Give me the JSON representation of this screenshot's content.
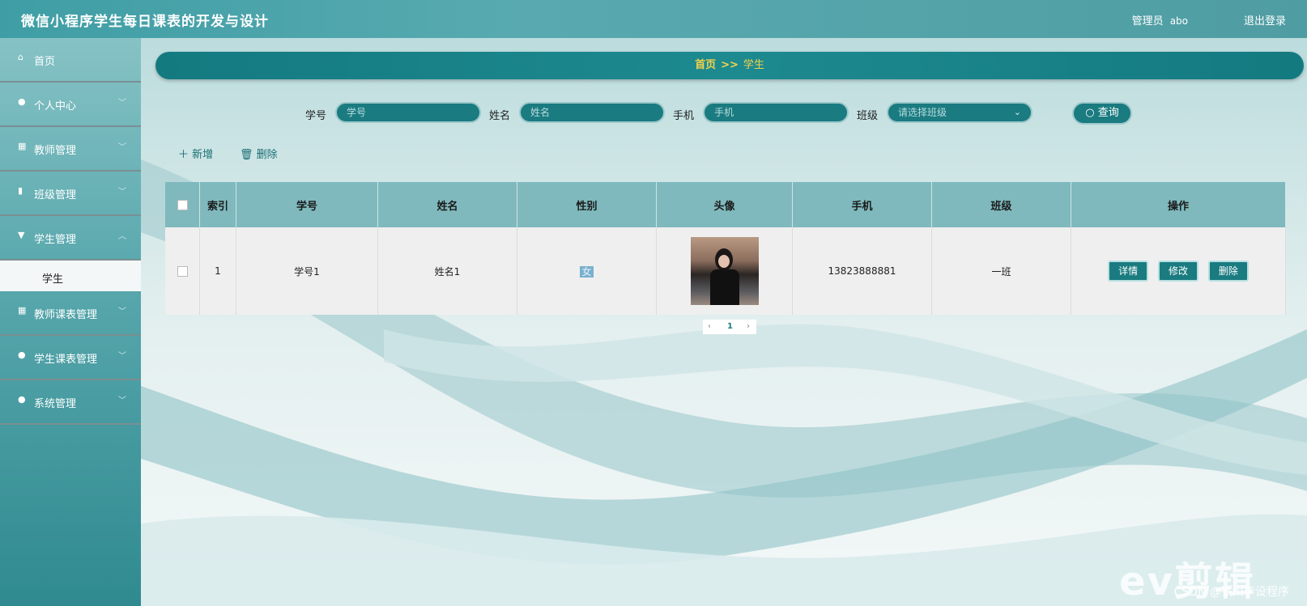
{
  "header": {
    "title": "微信小程序学生每日课表的开发与设计",
    "user_label": "管理员",
    "user_name": "abo",
    "logout": "退出登录"
  },
  "sidebar": {
    "items": [
      {
        "icon": "home-icon",
        "label": "首页"
      },
      {
        "icon": "user-icon",
        "label": "个人中心"
      },
      {
        "icon": "grid-icon",
        "label": "教师管理"
      },
      {
        "icon": "chart-icon",
        "label": "班级管理"
      },
      {
        "icon": "board-icon",
        "label": "学生管理"
      },
      {
        "icon": "grid-icon",
        "label": "教师课表管理"
      },
      {
        "icon": "bulb-icon",
        "label": "学生课表管理"
      },
      {
        "icon": "user-icon",
        "label": "系统管理"
      }
    ],
    "active_sub": "学生"
  },
  "breadcrumb": {
    "home": "首页",
    "sep": ">>",
    "current": "学生"
  },
  "search": {
    "id_label": "学号",
    "id_placeholder": "学号",
    "name_label": "姓名",
    "name_placeholder": "姓名",
    "phone_label": "手机",
    "phone_placeholder": "手机",
    "class_label": "班级",
    "class_placeholder": "请选择班级",
    "query_button": "查询"
  },
  "actions": {
    "add": "新增",
    "delete": "删除"
  },
  "table": {
    "headers": [
      "索引",
      "学号",
      "姓名",
      "性别",
      "头像",
      "手机",
      "班级",
      "操作"
    ],
    "rows": [
      {
        "index": "1",
        "student_id": "学号1",
        "name": "姓名1",
        "gender": "女",
        "phone": "13823888881",
        "class": "一班"
      }
    ],
    "row_actions": {
      "detail": "详情",
      "edit": "修改",
      "delete": "删除"
    }
  },
  "pager": {
    "prev": "‹",
    "page": "1",
    "next": "›"
  },
  "watermark": {
    "logo": "ev剪辑",
    "text": "CSDN @铁川毕设程序"
  },
  "colors": {
    "accent": "#1a7b80",
    "header": "#4fa3a9",
    "breadcrumb_text": "#f3d34a"
  }
}
